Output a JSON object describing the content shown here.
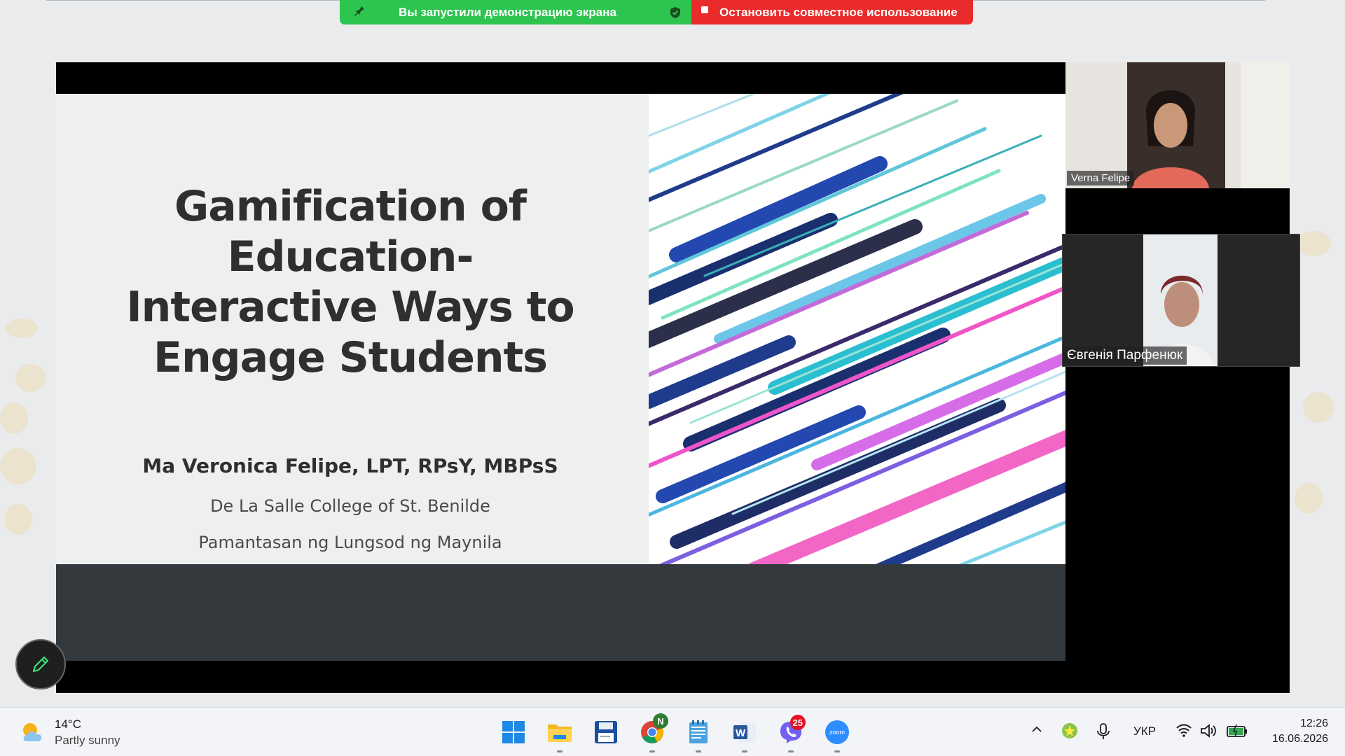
{
  "share_banner": {
    "status_text": "Вы запустили демонстрацию экрана",
    "stop_label": "Остановить совместное использование"
  },
  "slide": {
    "title_lines": [
      "Gamification of",
      "Education-",
      "Interactive Ways to",
      "Engage Students"
    ],
    "author": "Ma Veronica Felipe, LPT, RPsY, MBPsS",
    "affiliation_1": "De La Salle College of St. Benilde",
    "affiliation_2": "Pamantasan ng Lungsod ng Maynila"
  },
  "participants": [
    {
      "name": "Verna Felipe"
    },
    {
      "name": "Євгенія Парфенюк"
    }
  ],
  "taskbar": {
    "weather": {
      "temp": "14°C",
      "condition": "Partly sunny",
      "icon": "partly-sunny-icon"
    },
    "apps": [
      {
        "name": "windows-start-icon"
      },
      {
        "name": "file-explorer-icon"
      },
      {
        "name": "save-app-icon"
      },
      {
        "name": "chrome-icon",
        "badge": "N"
      },
      {
        "name": "notepad-icon"
      },
      {
        "name": "word-icon"
      },
      {
        "name": "viber-icon",
        "badge": "25"
      },
      {
        "name": "zoom-icon",
        "label": "zoom"
      }
    ],
    "language": "УКР",
    "time": "12:26",
    "date": "16.06.2026"
  },
  "colors": {
    "share_green": "#2ec450",
    "share_red": "#e92b2b",
    "slide_footer": "#33393c"
  }
}
